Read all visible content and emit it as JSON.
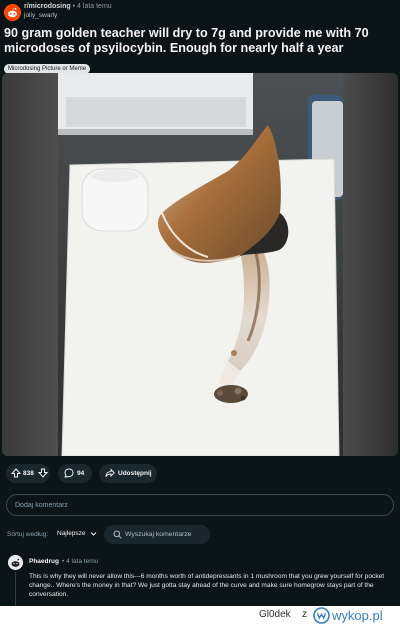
{
  "post": {
    "subreddit": "r/microdosing",
    "separator": "•",
    "time": "4 lata temu",
    "author": "jolly_swarly",
    "title": "90 gram golden teacher will dry to 7g and provide me with 70 microdoses of psyilocybin. Enough for nearly half a year",
    "flair": "Microdosing Picture or Meme"
  },
  "actions": {
    "votes": "838",
    "comments": "94",
    "share_label": "Udostępnij"
  },
  "comment_box": {
    "placeholder": "Dodaj komentarz"
  },
  "sort": {
    "label": "Sortuj według:",
    "selected": "Najlepsze",
    "search_placeholder": "Wyszukaj komentarze"
  },
  "comment": {
    "author": "Phaedrug",
    "separator": "•",
    "time": "4 lata temu",
    "body": "This is why they will never allow this---6 months worth of antidepressants in 1 mushroom that you grew yourself for pocket change.. Where's the money in that? We just gotta stay ahead of the curve and make sure homegrow stays part of the conversation."
  },
  "watermark": {
    "user": "Gl0dek",
    "separator": "z",
    "site": "wykop.pl"
  },
  "colors": {
    "background": "#0b1416",
    "brand": "#ff4500",
    "pill": "#1a282d",
    "wykop_blue": "#347dc4"
  }
}
